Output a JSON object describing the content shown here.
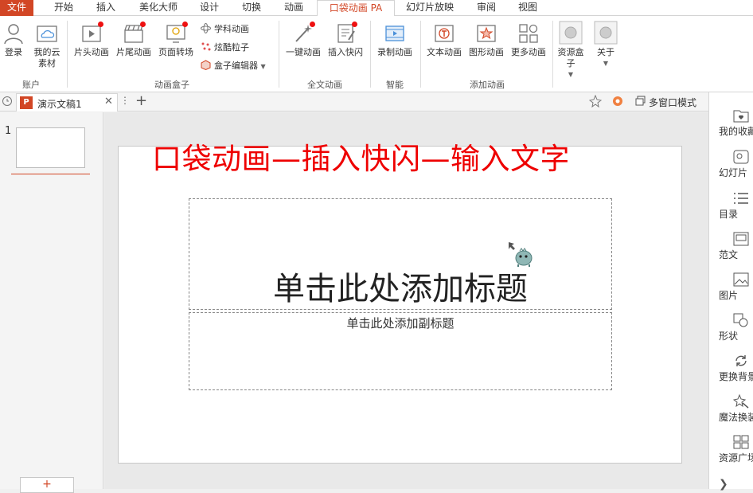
{
  "tabs": [
    "文件",
    "开始",
    "插入",
    "美化大师",
    "设计",
    "切换",
    "动画",
    "口袋动画 PA",
    "幻灯片放映",
    "审阅",
    "视图"
  ],
  "ribbon": {
    "account": {
      "login": "登录",
      "cloud": "我的云素材",
      "group": "账户"
    },
    "anim_box": {
      "head": "片头动画",
      "tail": "片尾动画",
      "page": "页面转场",
      "subject": "学科动画",
      "particle": "炫酷粒子",
      "box_editor": "盒子编辑器",
      "group": "动画盒子"
    },
    "full_text": {
      "one_key": "一键动画",
      "insert_flash": "插入快闪",
      "group": "全文动画"
    },
    "smart": {
      "record": "录制动画",
      "group": "智能"
    },
    "add_anim": {
      "text": "文本动画",
      "shape": "图形动画",
      "more": "更多动画",
      "group": "添加动画"
    },
    "resource_box": "资源盒子",
    "about": "关于"
  },
  "doc": {
    "name": "演示文稿1",
    "multi_window": "多窗口模式"
  },
  "thumbs": {
    "slide_number": "1",
    "add_label": "+"
  },
  "slide": {
    "overlay_title": "口袋动画—插入快闪—输入文字",
    "title_placeholder": "单击此处添加标题",
    "subtitle_placeholder": "单击此处添加副标题"
  },
  "side_panel": [
    "我的收藏",
    "幻灯片",
    "目录",
    "范文",
    "图片",
    "形状",
    "更换背景",
    "魔法换装",
    "资源广场"
  ],
  "colors": {
    "accent": "#d24625",
    "overlay_text": "#e00000"
  }
}
